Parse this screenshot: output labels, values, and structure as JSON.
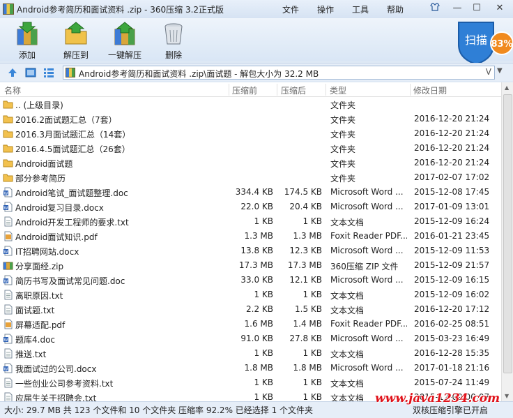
{
  "window": {
    "title": "Android参考简历和面试资料 .zip - 360压缩 3.2正式版",
    "menu": [
      "文件",
      "操作",
      "工具",
      "帮助"
    ]
  },
  "toolbar": {
    "add_label": "添加",
    "extract_to_label": "解压到",
    "one_click_label": "一键解压",
    "delete_label": "删除"
  },
  "scan": {
    "label": "扫描",
    "percent": "83%"
  },
  "address": {
    "path": "Android参考简历和面试资料 .zip\\面试题 - 解包大小为 32.2 MB",
    "v": "V"
  },
  "columns": {
    "name": "名称",
    "size": "压缩前",
    "packed": "压缩后",
    "type": "类型",
    "date": "修改日期"
  },
  "files": [
    {
      "icon": "folder",
      "name": ".. (上级目录)",
      "size": "",
      "packed": "",
      "type": "文件夹",
      "date": ""
    },
    {
      "icon": "folder",
      "name": "2016.2面试题汇总（7套）",
      "size": "",
      "packed": "",
      "type": "文件夹",
      "date": "2016-12-20 21:24"
    },
    {
      "icon": "folder",
      "name": "2016.3月面试题汇总（14套）",
      "size": "",
      "packed": "",
      "type": "文件夹",
      "date": "2016-12-20 21:24"
    },
    {
      "icon": "folder",
      "name": "2016.4.5面试题汇总（26套）",
      "size": "",
      "packed": "",
      "type": "文件夹",
      "date": "2016-12-20 21:24"
    },
    {
      "icon": "folder",
      "name": "Android面试题",
      "size": "",
      "packed": "",
      "type": "文件夹",
      "date": "2016-12-20 21:24"
    },
    {
      "icon": "folder",
      "name": "部分参考简历",
      "size": "",
      "packed": "",
      "type": "文件夹",
      "date": "2017-02-07 17:02"
    },
    {
      "icon": "doc",
      "name": "Android笔试_面试题整理.doc",
      "size": "334.4 KB",
      "packed": "174.5 KB",
      "type": "Microsoft Word ...",
      "date": "2015-12-08 17:45"
    },
    {
      "icon": "doc",
      "name": "Android复习目录.docx",
      "size": "22.0 KB",
      "packed": "20.4 KB",
      "type": "Microsoft Word ...",
      "date": "2017-01-09 13:01"
    },
    {
      "icon": "txt",
      "name": "Android开发工程师的要求.txt",
      "size": "1 KB",
      "packed": "1 KB",
      "type": "文本文档",
      "date": "2015-12-09 16:24"
    },
    {
      "icon": "pdf",
      "name": "Android面试知识.pdf",
      "size": "1.3 MB",
      "packed": "1.3 MB",
      "type": "Foxit Reader PDF...",
      "date": "2016-01-21 23:45"
    },
    {
      "icon": "doc",
      "name": "IT招聘网站.docx",
      "size": "13.8 KB",
      "packed": "12.3 KB",
      "type": "Microsoft Word ...",
      "date": "2015-12-09 11:53"
    },
    {
      "icon": "zip",
      "name": "分享面经.zip",
      "size": "17.3 MB",
      "packed": "17.3 MB",
      "type": "360压缩 ZIP 文件",
      "date": "2015-12-09 21:57"
    },
    {
      "icon": "doc",
      "name": "简历书写及面试常见问题.doc",
      "size": "33.0 KB",
      "packed": "12.1 KB",
      "type": "Microsoft Word ...",
      "date": "2015-12-09 16:15"
    },
    {
      "icon": "txt",
      "name": "离职原因.txt",
      "size": "1 KB",
      "packed": "1 KB",
      "type": "文本文档",
      "date": "2015-12-09 16:02"
    },
    {
      "icon": "txt",
      "name": "面试题.txt",
      "size": "2.2 KB",
      "packed": "1.5 KB",
      "type": "文本文档",
      "date": "2016-12-20 17:12"
    },
    {
      "icon": "pdf",
      "name": "屏幕适配.pdf",
      "size": "1.6 MB",
      "packed": "1.4 MB",
      "type": "Foxit Reader PDF...",
      "date": "2016-02-25 08:51"
    },
    {
      "icon": "doc",
      "name": "题库4.doc",
      "size": "91.0 KB",
      "packed": "27.8 KB",
      "type": "Microsoft Word ...",
      "date": "2015-03-23 16:49"
    },
    {
      "icon": "txt",
      "name": "推送.txt",
      "size": "1 KB",
      "packed": "1 KB",
      "type": "文本文档",
      "date": "2016-12-28 15:35"
    },
    {
      "icon": "doc",
      "name": "我面试过的公司.docx",
      "size": "1.8 MB",
      "packed": "1.8 MB",
      "type": "Microsoft Word ...",
      "date": "2017-01-18 21:16"
    },
    {
      "icon": "txt",
      "name": "一些创业公司参考资料.txt",
      "size": "1 KB",
      "packed": "1 KB",
      "type": "文本文档",
      "date": "2015-07-24 11:49"
    },
    {
      "icon": "txt",
      "name": "应届生关于招聘会.txt",
      "size": "1 KB",
      "packed": "1 KB",
      "type": "文本文档",
      "date": "2015-12-09 00:07"
    }
  ],
  "status": {
    "text": "大小: 29.7 MB 共 123 个文件和 10 个文件夹 压缩率 92.2% 已经选择 1 个文件夹",
    "right": "双核压缩引擎已开启"
  },
  "watermark": "www.java1234.com"
}
